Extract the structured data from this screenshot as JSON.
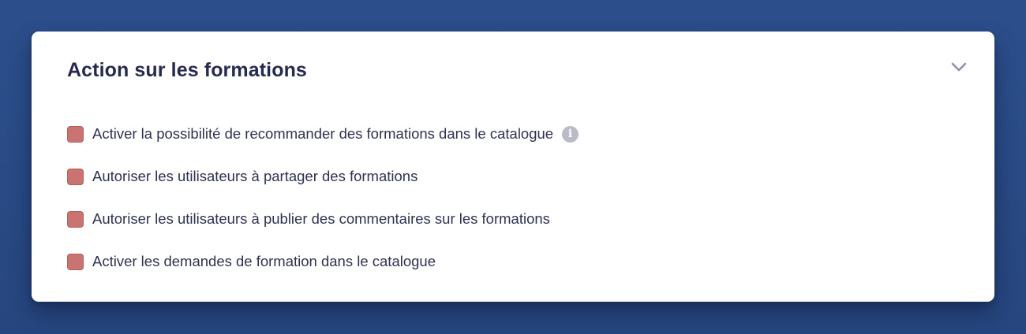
{
  "panel": {
    "title": "Action sur les formations",
    "collapse_icon": "chevron-down-icon"
  },
  "options": [
    {
      "label": "Activer la possibilité de recommander des formations dans le catalogue",
      "checked": false,
      "has_info": true
    },
    {
      "label": "Autoriser les utilisateurs à partager des formations",
      "checked": false,
      "has_info": false
    },
    {
      "label": "Autoriser les utilisateurs à publier des commentaires sur les formations",
      "checked": false,
      "has_info": false
    },
    {
      "label": "Activer les demandes de formation dans le catalogue",
      "checked": false,
      "has_info": false
    }
  ],
  "info_icon": {
    "glyph": "i",
    "name": "info-icon"
  },
  "colors": {
    "background": "#2c4f8c",
    "card": "#ffffff",
    "title": "#262a4f",
    "text": "#2f3252",
    "checkbox_fill": "#c97472",
    "info_icon": "#b9bcc8",
    "chevron": "#8e93a6"
  }
}
